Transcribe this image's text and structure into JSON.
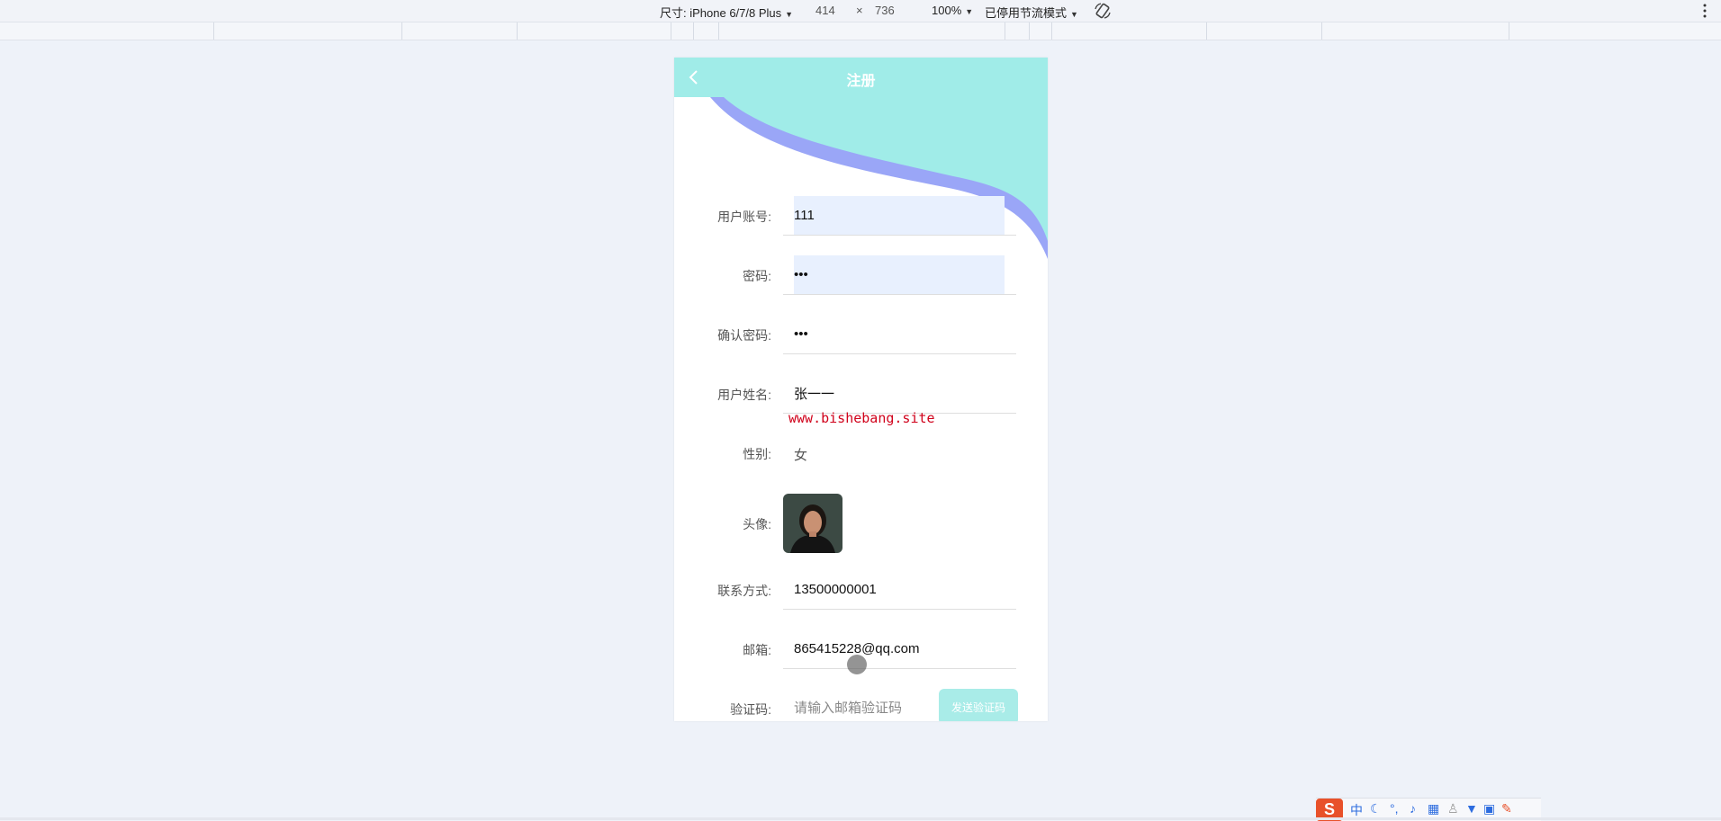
{
  "devtools": {
    "device_label": "尺寸: iPhone 6/7/8 Plus",
    "width": "414",
    "times": "×",
    "height": "736",
    "zoom": "100%",
    "throttle": "已停用节流模式"
  },
  "page": {
    "title": "注册",
    "back_icon": "chevron-left-icon"
  },
  "form": {
    "account": {
      "label": "用户账号:",
      "value": "111"
    },
    "password": {
      "label": "密码:",
      "value": "•••"
    },
    "confirm_password": {
      "label": "确认密码:",
      "value": "•••"
    },
    "name": {
      "label": "用户姓名:",
      "value": "张一一"
    },
    "gender": {
      "label": "性别:",
      "value": "女"
    },
    "avatar": {
      "label": "头像:"
    },
    "phone": {
      "label": "联系方式:",
      "value": "13500000001"
    },
    "email": {
      "label": "邮箱:",
      "value": "865415228@qq.com"
    },
    "code": {
      "label": "验证码:",
      "placeholder": "请输入邮箱验证码",
      "button": "发送验证码"
    }
  },
  "watermark": "www.bishebang.site",
  "ime": {
    "mode": "中"
  },
  "colors": {
    "header": "#a0ece8",
    "wave": "#9aa6f7",
    "watermark": "#d0021b",
    "send_button": "#a9ece8"
  }
}
